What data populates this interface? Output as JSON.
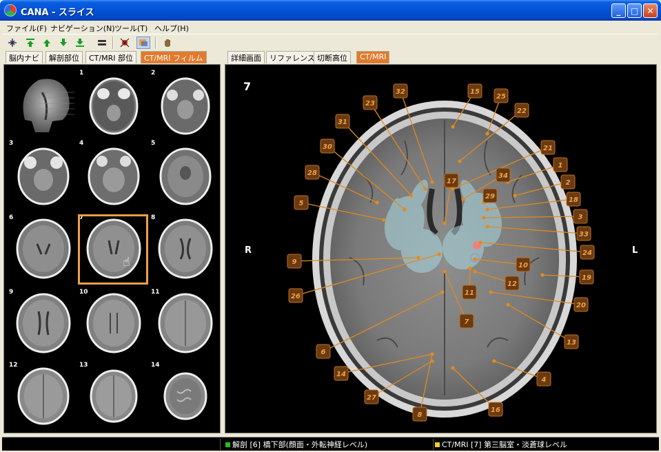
{
  "window": {
    "title": "CANA - スライス",
    "controls": {
      "minimize": "_",
      "maximize": "□",
      "close": "✕"
    }
  },
  "menu": [
    "ファイル(F)",
    "ナビゲーション(N)",
    "ツール(T)",
    "ヘルプ(H)"
  ],
  "toolbar": {
    "icons": [
      "fit-icon",
      "first-icon",
      "up-icon",
      "down-icon",
      "last-icon",
      "stack-icon",
      "target-icon",
      "overlay-icon",
      "hand-icon"
    ]
  },
  "left_tabs": [
    {
      "label": "脳内ナビ",
      "active": false
    },
    {
      "label": "解剖部位",
      "active": false
    },
    {
      "label": "CT/MRI 部位",
      "active": false
    },
    {
      "label": "CT/MRI フィルム",
      "active": true
    }
  ],
  "right_tabs": [
    {
      "label": "詳細画面",
      "active": false
    },
    {
      "label": "リファレンス",
      "active": false
    },
    {
      "label": "切断高位",
      "active": false
    },
    {
      "label": "CT/MRI",
      "active": true
    }
  ],
  "thumbnails": [
    {
      "num": ""
    },
    {
      "num": "1"
    },
    {
      "num": "2"
    },
    {
      "num": "3"
    },
    {
      "num": "4"
    },
    {
      "num": "5"
    },
    {
      "num": "6"
    },
    {
      "num": "7"
    },
    {
      "num": "8"
    },
    {
      "num": "9"
    },
    {
      "num": "10"
    },
    {
      "num": "11"
    },
    {
      "num": "12"
    },
    {
      "num": "13"
    },
    {
      "num": "14"
    }
  ],
  "selected_thumbnail": "7",
  "viewer": {
    "slice_number": "7",
    "left_side": "R",
    "right_side": "L",
    "markers": [
      "32",
      "23",
      "15",
      "25",
      "22",
      "31",
      "30",
      "21",
      "28",
      "34",
      "1",
      "17",
      "2",
      "5",
      "29",
      "18",
      "3",
      "33",
      "24",
      "9",
      "10",
      "19",
      "12",
      "26",
      "11",
      "20",
      "7",
      "13",
      "6",
      "14",
      "27",
      "4",
      "8",
      "16"
    ]
  },
  "status": {
    "left": "",
    "middle": "解剖 [6] 橋下部(顔面・外転神経レベル)",
    "right": "CT/MRI [7] 第三脳室・淡蒼球レベル",
    "middle_color": "#20c020",
    "right_color": "#f0d020"
  },
  "colors": {
    "accent": "#e07b2e",
    "marker_bg": "#6a3a12",
    "marker_text": "#f0a040",
    "leader": "#e08a20"
  }
}
